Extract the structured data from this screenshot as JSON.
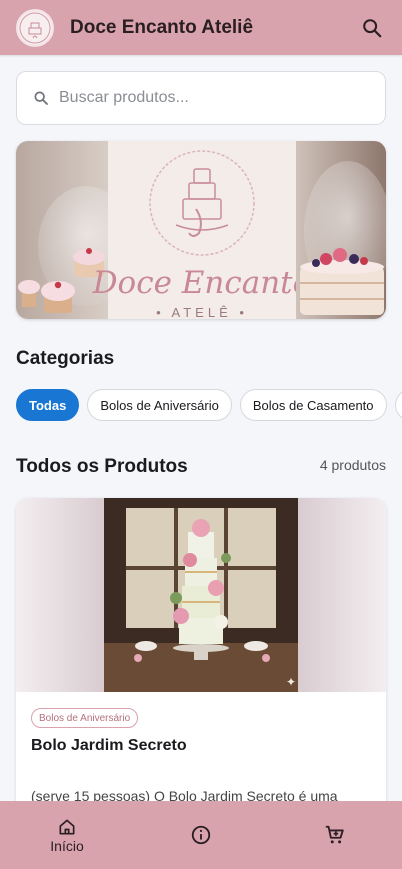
{
  "header": {
    "title": "Doce Encanto Ateliê",
    "logo_icon": "cake-logo-icon",
    "search_icon": "search-icon",
    "background": "#d9a3ae"
  },
  "search": {
    "placeholder": "Buscar produtos...",
    "value": ""
  },
  "banner": {
    "brand_name": "Doce Encanto",
    "brand_subtitle": "• ATELÊ •"
  },
  "categories": {
    "title": "Categorias",
    "chips": [
      {
        "label": "Todas",
        "active": true
      },
      {
        "label": "Bolos de Aniversário",
        "active": false
      },
      {
        "label": "Bolos de Casamento",
        "active": false
      }
    ],
    "accent": "#1976d2"
  },
  "products": {
    "title": "Todos os Produtos",
    "count_label": "4 produtos",
    "items": [
      {
        "category": "Bolos de Aniversário",
        "name": "Bolo Jardim Secreto",
        "description": "(serve 15 pessoas) O Bolo Jardim Secreto é uma"
      }
    ]
  },
  "bottom_nav": {
    "items": [
      {
        "label": "Início",
        "icon": "home-icon"
      },
      {
        "label": "",
        "icon": "info-icon"
      },
      {
        "label": "",
        "icon": "cart-icon"
      }
    ]
  }
}
